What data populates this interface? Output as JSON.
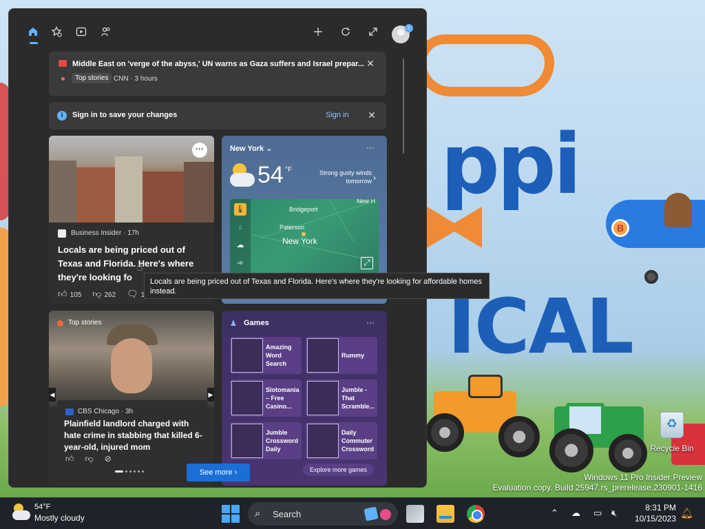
{
  "desktop": {
    "wallpaper_text_1": "ppi",
    "wallpaper_text_2": "ICAL",
    "plane_badge": "B",
    "recycle_bin_label": "Recycle Bin",
    "watermark_line1": "Windows 11 Pro Insider Preview",
    "watermark_line2": "Evaluation copy. Build 25947.rs_prerelease.230901-1416"
  },
  "widgets": {
    "nav_icons": [
      "home-icon",
      "star-add-icon",
      "video-icon",
      "people-icon"
    ],
    "action_icons": [
      "plus-icon",
      "refresh-icon",
      "expand-icon"
    ],
    "avatar_badge": "i",
    "top_news": {
      "title": "Middle East on 'verge of the abyss,' UN warns as Gaza suffers and Israel prepar...",
      "tag": "Top stories",
      "source": "CNN · 3 hours"
    },
    "signin_bar": {
      "info_glyph": "i",
      "text": "Sign in to save your changes",
      "link": "Sign in"
    },
    "article1": {
      "more_label": "···",
      "source": "Business Insider · 17h",
      "title": "Locals are being priced out of Texas and Florida. Here's where they're looking fo",
      "likes": "105",
      "dislikes": "262",
      "comments": "13"
    },
    "weather": {
      "location": "New York",
      "more_label": "···",
      "temperature": "54",
      "unit": "°F",
      "alert": "Strong gusty winds tomorrow",
      "map_labels": {
        "bridgeport": "Bridgeport",
        "new_h": "New H",
        "paterson": "Paterson",
        "new_york": "New York"
      }
    },
    "tooltip": "Locals are being priced out of Texas and Florida. Here's where they're looking for affordable homes instead.",
    "article2": {
      "tag": "Top stories",
      "source": "CBS Chicago · 3h",
      "title": "Plainfield landlord charged with hate crime in stabbing that killed 6-year-old, injured mom",
      "prev_arrow": "◀",
      "next_arrow": "▶",
      "pager_dots": 6,
      "pager_active": 0
    },
    "games": {
      "title": "Games",
      "more_label": "···",
      "tiles": [
        {
          "name": "Amazing Word Search"
        },
        {
          "name": "Rummy"
        },
        {
          "name": "Slotomania – Free Casino..."
        },
        {
          "name": "Jumble - That Scramble..."
        },
        {
          "name": "Jumble Crossword Daily"
        },
        {
          "name": "Daily Commuter Crossword"
        }
      ],
      "explore": "Explore more games"
    },
    "see_more": "See more ›"
  },
  "taskbar": {
    "weather_temp": "54°F",
    "weather_cond": "Mostly cloudy",
    "search_label": "Search",
    "apps": [
      "start-button",
      "task-view-icon",
      "file-explorer-icon",
      "chrome-icon"
    ],
    "clock_time": "8:31 PM",
    "clock_date": "10/15/2023"
  }
}
